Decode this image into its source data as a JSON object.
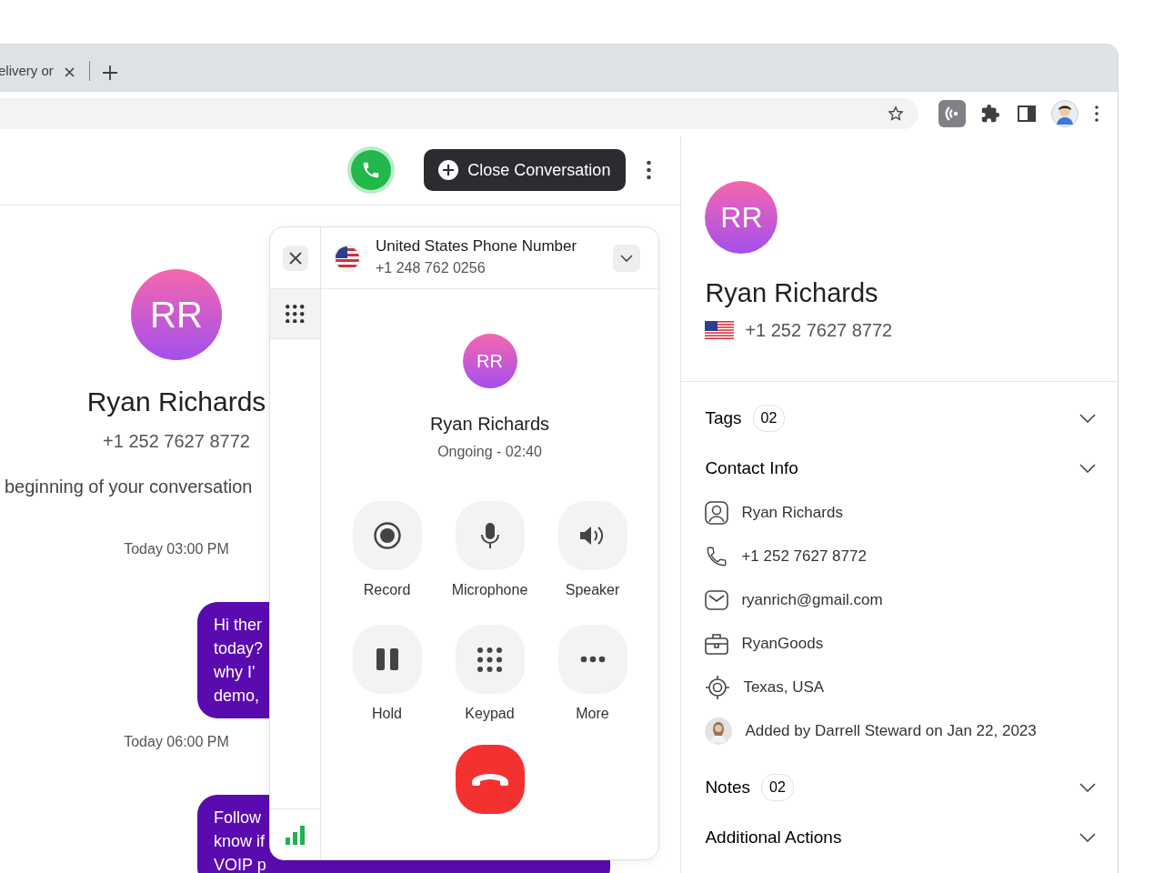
{
  "browser": {
    "tab_title": "elivery or"
  },
  "header": {
    "action_button": "Close Conversation"
  },
  "conversation": {
    "initials": "RR",
    "name": "Ryan Richards",
    "phone": "+1 252 7627 8772",
    "intro": "beginning of your conversation",
    "messages": [
      {
        "time": "Today 03:00 PM",
        "lines": [
          "Hi ther",
          "today?",
          "why I'",
          "demo,"
        ]
      },
      {
        "time": "Today 06:00 PM",
        "lines": [
          "Follow",
          "know if",
          "VOIP p"
        ]
      }
    ]
  },
  "dialer": {
    "line_name": "United States Phone Number",
    "line_number": "+1 248 762 0256",
    "side_tabs": [
      {
        "kind": "keypad",
        "selected": true
      }
    ],
    "contact": {
      "initials": "RR",
      "name": "Ryan Richards",
      "status": "Ongoing - 02:40"
    },
    "actions": [
      {
        "kind": "record",
        "label": "Record"
      },
      {
        "kind": "microphone",
        "label": "Microphone"
      },
      {
        "kind": "speaker",
        "label": "Speaker"
      },
      {
        "kind": "hold",
        "label": "Hold"
      },
      {
        "kind": "keypad",
        "label": "Keypad"
      },
      {
        "kind": "more",
        "label": "More"
      }
    ]
  },
  "profile": {
    "initials": "RR",
    "name": "Ryan Richards",
    "phone": "+1 252 7627 8772"
  },
  "sections": [
    {
      "title": "Tags",
      "count": "02"
    },
    {
      "title": "Contact Info",
      "items": [
        {
          "kind": "person",
          "text": "Ryan Richards"
        },
        {
          "kind": "phone",
          "text": "+1 252 7627 8772"
        },
        {
          "kind": "email",
          "text": "ryanrich@gmail.com"
        },
        {
          "kind": "company",
          "text": "RyanGoods"
        },
        {
          "kind": "location",
          "text": "Texas, USA"
        },
        {
          "kind": "added",
          "text": "Added by Darrell Steward on Jan 22, 2023"
        }
      ]
    },
    {
      "title": "Notes",
      "count": "02"
    },
    {
      "title": "Additional Actions"
    }
  ]
}
